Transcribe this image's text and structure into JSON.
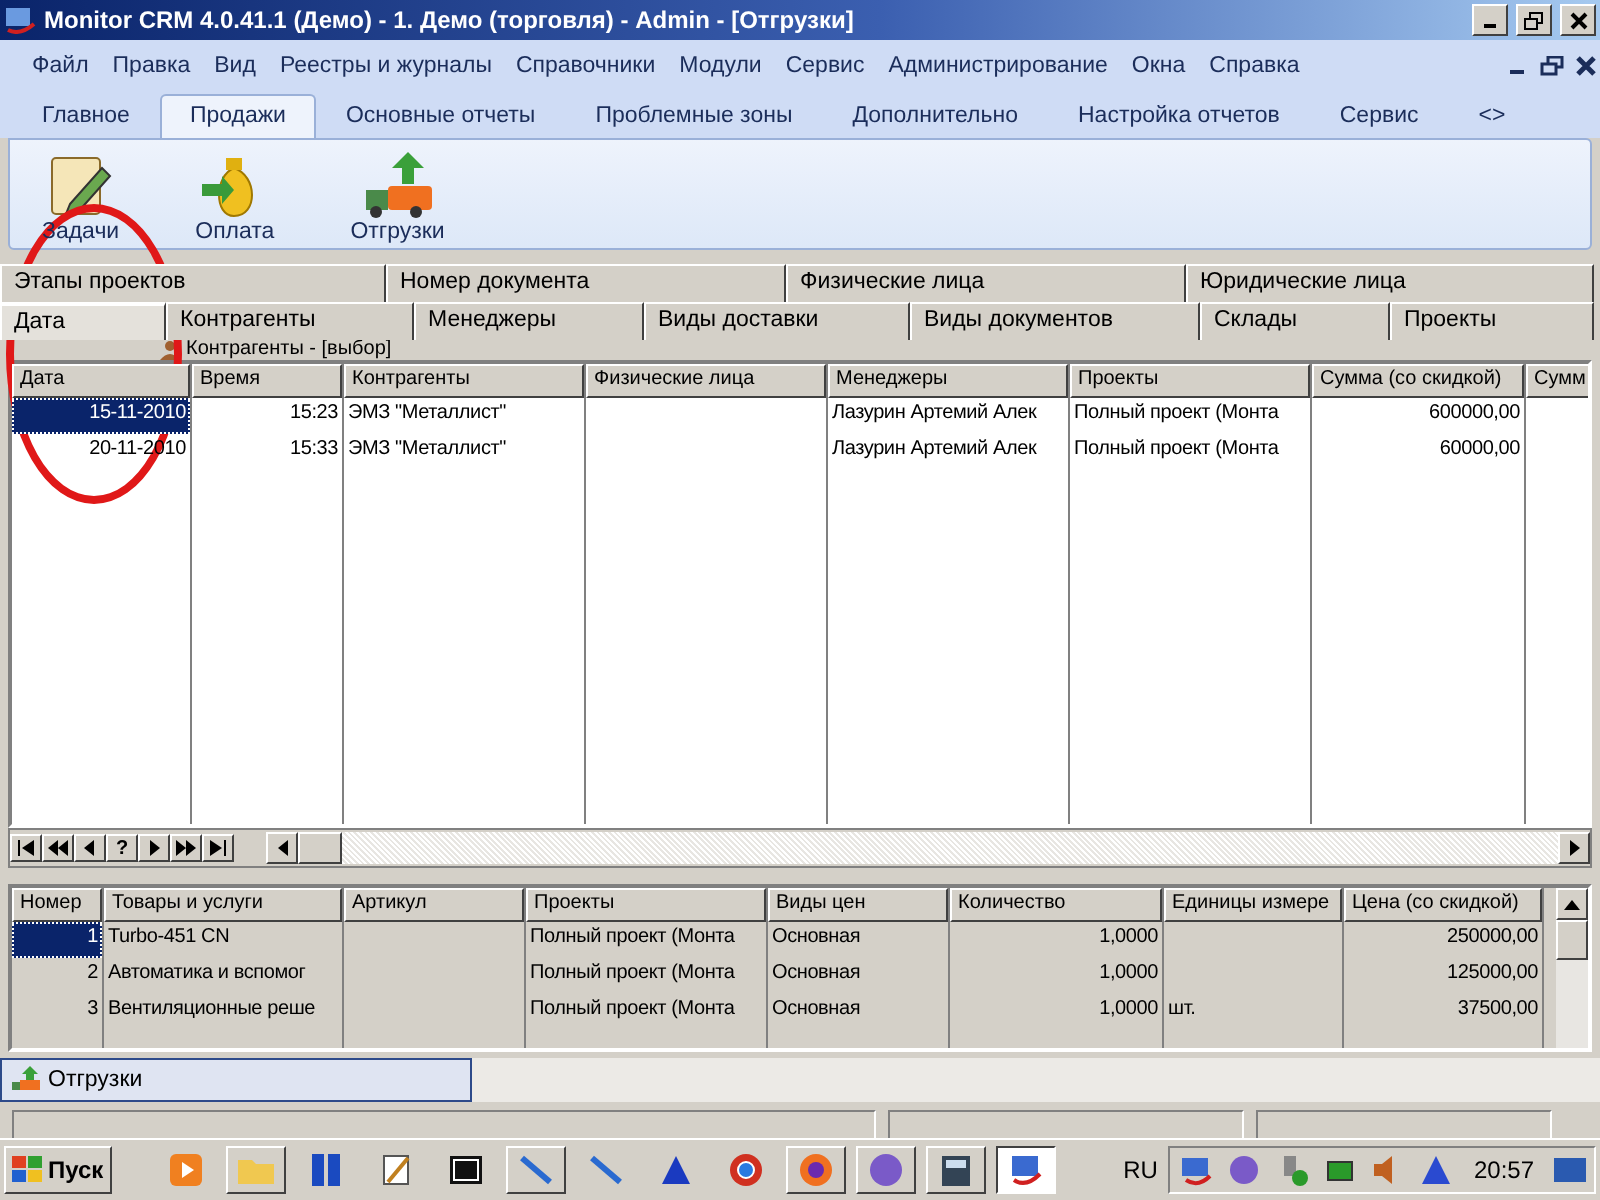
{
  "window": {
    "title": "Monitor CRM 4.0.41.1 (Демо) - 1. Демо (торговля) - Admin - [Отгрузки]"
  },
  "menu": [
    "Файл",
    "Правка",
    "Вид",
    "Реестры и журналы",
    "Справочники",
    "Модули",
    "Сервис",
    "Администрирование",
    "Окна",
    "Справка"
  ],
  "ribbon_tabs": [
    {
      "label": "Главное",
      "selected": false
    },
    {
      "label": "Продажи",
      "selected": true
    },
    {
      "label": "Основные отчеты",
      "selected": false
    },
    {
      "label": "Проблемные зоны",
      "selected": false
    },
    {
      "label": "Дополнительно",
      "selected": false
    },
    {
      "label": "Настройка отчетов",
      "selected": false
    },
    {
      "label": "Сервис",
      "selected": false
    },
    {
      "label": "<>",
      "selected": false
    }
  ],
  "ribbon_buttons": [
    {
      "label": "Задачи",
      "kind": "tasks"
    },
    {
      "label": "Оплата",
      "kind": "payment"
    },
    {
      "label": "Отгрузки",
      "kind": "shipment"
    }
  ],
  "filter_tabs": [
    [
      {
        "label": "Этапы проектов",
        "selected": false
      },
      {
        "label": "Номер документа",
        "selected": false
      },
      {
        "label": "Физические лица",
        "selected": false
      },
      {
        "label": "Юридические лица",
        "selected": false
      }
    ],
    [
      {
        "label": "Дата",
        "selected": true
      },
      {
        "label": "Контрагенты",
        "selected": false
      },
      {
        "label": "Менеджеры",
        "selected": false
      },
      {
        "label": "Виды доставки",
        "selected": false
      },
      {
        "label": "Виды документов",
        "selected": false
      },
      {
        "label": "Склады",
        "selected": false
      },
      {
        "label": "Проекты",
        "selected": false
      }
    ]
  ],
  "child_window": {
    "title": "Контрагенты - [выбор]"
  },
  "grid": {
    "columns": [
      {
        "label": "Дата"
      },
      {
        "label": "Время"
      },
      {
        "label": "Контрагенты"
      },
      {
        "label": "Физические лица"
      },
      {
        "label": "Менеджеры"
      },
      {
        "label": "Проекты"
      },
      {
        "label": "Сумма (со скидкой)"
      },
      {
        "label": "Сумм"
      }
    ],
    "rows": [
      {
        "selected": true,
        "cells": [
          "15-11-2010",
          "15:23",
          "ЭМЗ \"Металлист\"",
          null,
          "Лазурин Артемий Алек",
          "Полный проект (Монта",
          "600000,00",
          null
        ]
      },
      {
        "selected": false,
        "cells": [
          "20-11-2010",
          "15:33",
          "ЭМЗ \"Металлист\"",
          null,
          "Лазурин Артемий Алек",
          "Полный проект (Монта",
          "60000,00",
          null
        ]
      }
    ]
  },
  "navigator": [
    {
      "kind": "first"
    },
    {
      "kind": "prev-page"
    },
    {
      "kind": "prev"
    },
    {
      "kind": "text",
      "label": "?"
    },
    {
      "kind": "next"
    },
    {
      "kind": "next-page"
    },
    {
      "kind": "last"
    }
  ],
  "detail_grid": {
    "columns": [
      {
        "label": "Номер"
      },
      {
        "label": "Товары и услуги"
      },
      {
        "label": "Артикул"
      },
      {
        "label": "Проекты"
      },
      {
        "label": "Виды цен"
      },
      {
        "label": "Количество"
      },
      {
        "label": "Единицы измере"
      },
      {
        "label": "Цена (со скидкой)"
      }
    ],
    "rows": [
      {
        "selected": true,
        "cells": [
          "1",
          "Turbo-451 CN",
          null,
          "Полный проект (Монта",
          "Основная",
          "1,0000",
          null,
          "250000,00"
        ]
      },
      {
        "selected": false,
        "cells": [
          "2",
          "Автоматика и вспомог",
          null,
          "Полный проект (Монта",
          "Основная",
          "1,0000",
          null,
          "125000,00"
        ]
      },
      {
        "selected": false,
        "cells": [
          "3",
          "Вентиляционные реше",
          null,
          "Полный проект (Монта",
          "Основная",
          "1,0000",
          "шт.",
          "37500,00"
        ]
      }
    ]
  },
  "window_tabs": [
    {
      "label": "Отгрузки",
      "selected": true
    }
  ],
  "taskbar": {
    "start": "Пуск",
    "language": "RU",
    "clock": "20:57"
  }
}
